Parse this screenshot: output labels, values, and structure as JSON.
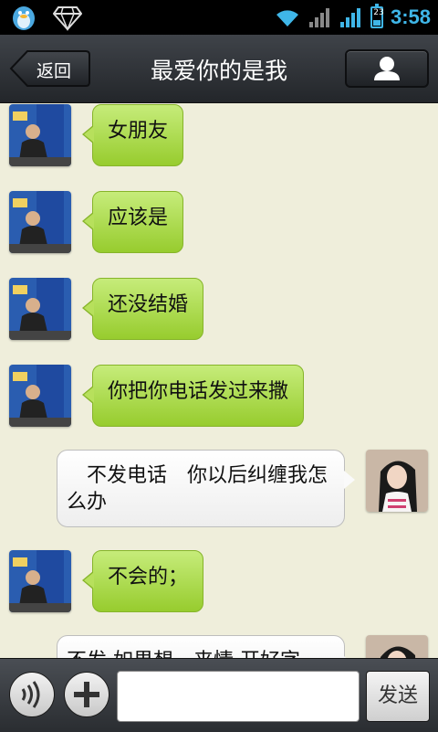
{
  "status_bar": {
    "time": "3:58",
    "battery_level": "23",
    "icons": [
      "qq-penguin-icon",
      "diamond-icon",
      "wifi-icon",
      "signal-icon",
      "signal-icon",
      "battery-icon"
    ]
  },
  "header": {
    "back_label": "返回",
    "title": "最爱你的是我",
    "profile_icon": "person-icon"
  },
  "messages": [
    {
      "side": "left",
      "text": "女朋友"
    },
    {
      "side": "left",
      "text": "应该是"
    },
    {
      "side": "left",
      "text": "还没结婚"
    },
    {
      "side": "left",
      "text": "你把你电话发过来撒"
    },
    {
      "side": "right",
      "text": "　不发电话　你以后纠缠我怎么办"
    },
    {
      "side": "left",
      "text": "不会的；"
    },
    {
      "side": "right",
      "text": "不发 如果想一来情 开好字"
    }
  ],
  "input_bar": {
    "voice_icon": "voice-icon",
    "plus_icon": "plus-icon",
    "input_value": "",
    "input_placeholder": "",
    "send_label": "发送"
  },
  "colors": {
    "background": "#efeedb",
    "incoming_bubble": "#b2dc50",
    "outgoing_bubble": "#ffffff",
    "status_accent": "#3fb6e8"
  }
}
